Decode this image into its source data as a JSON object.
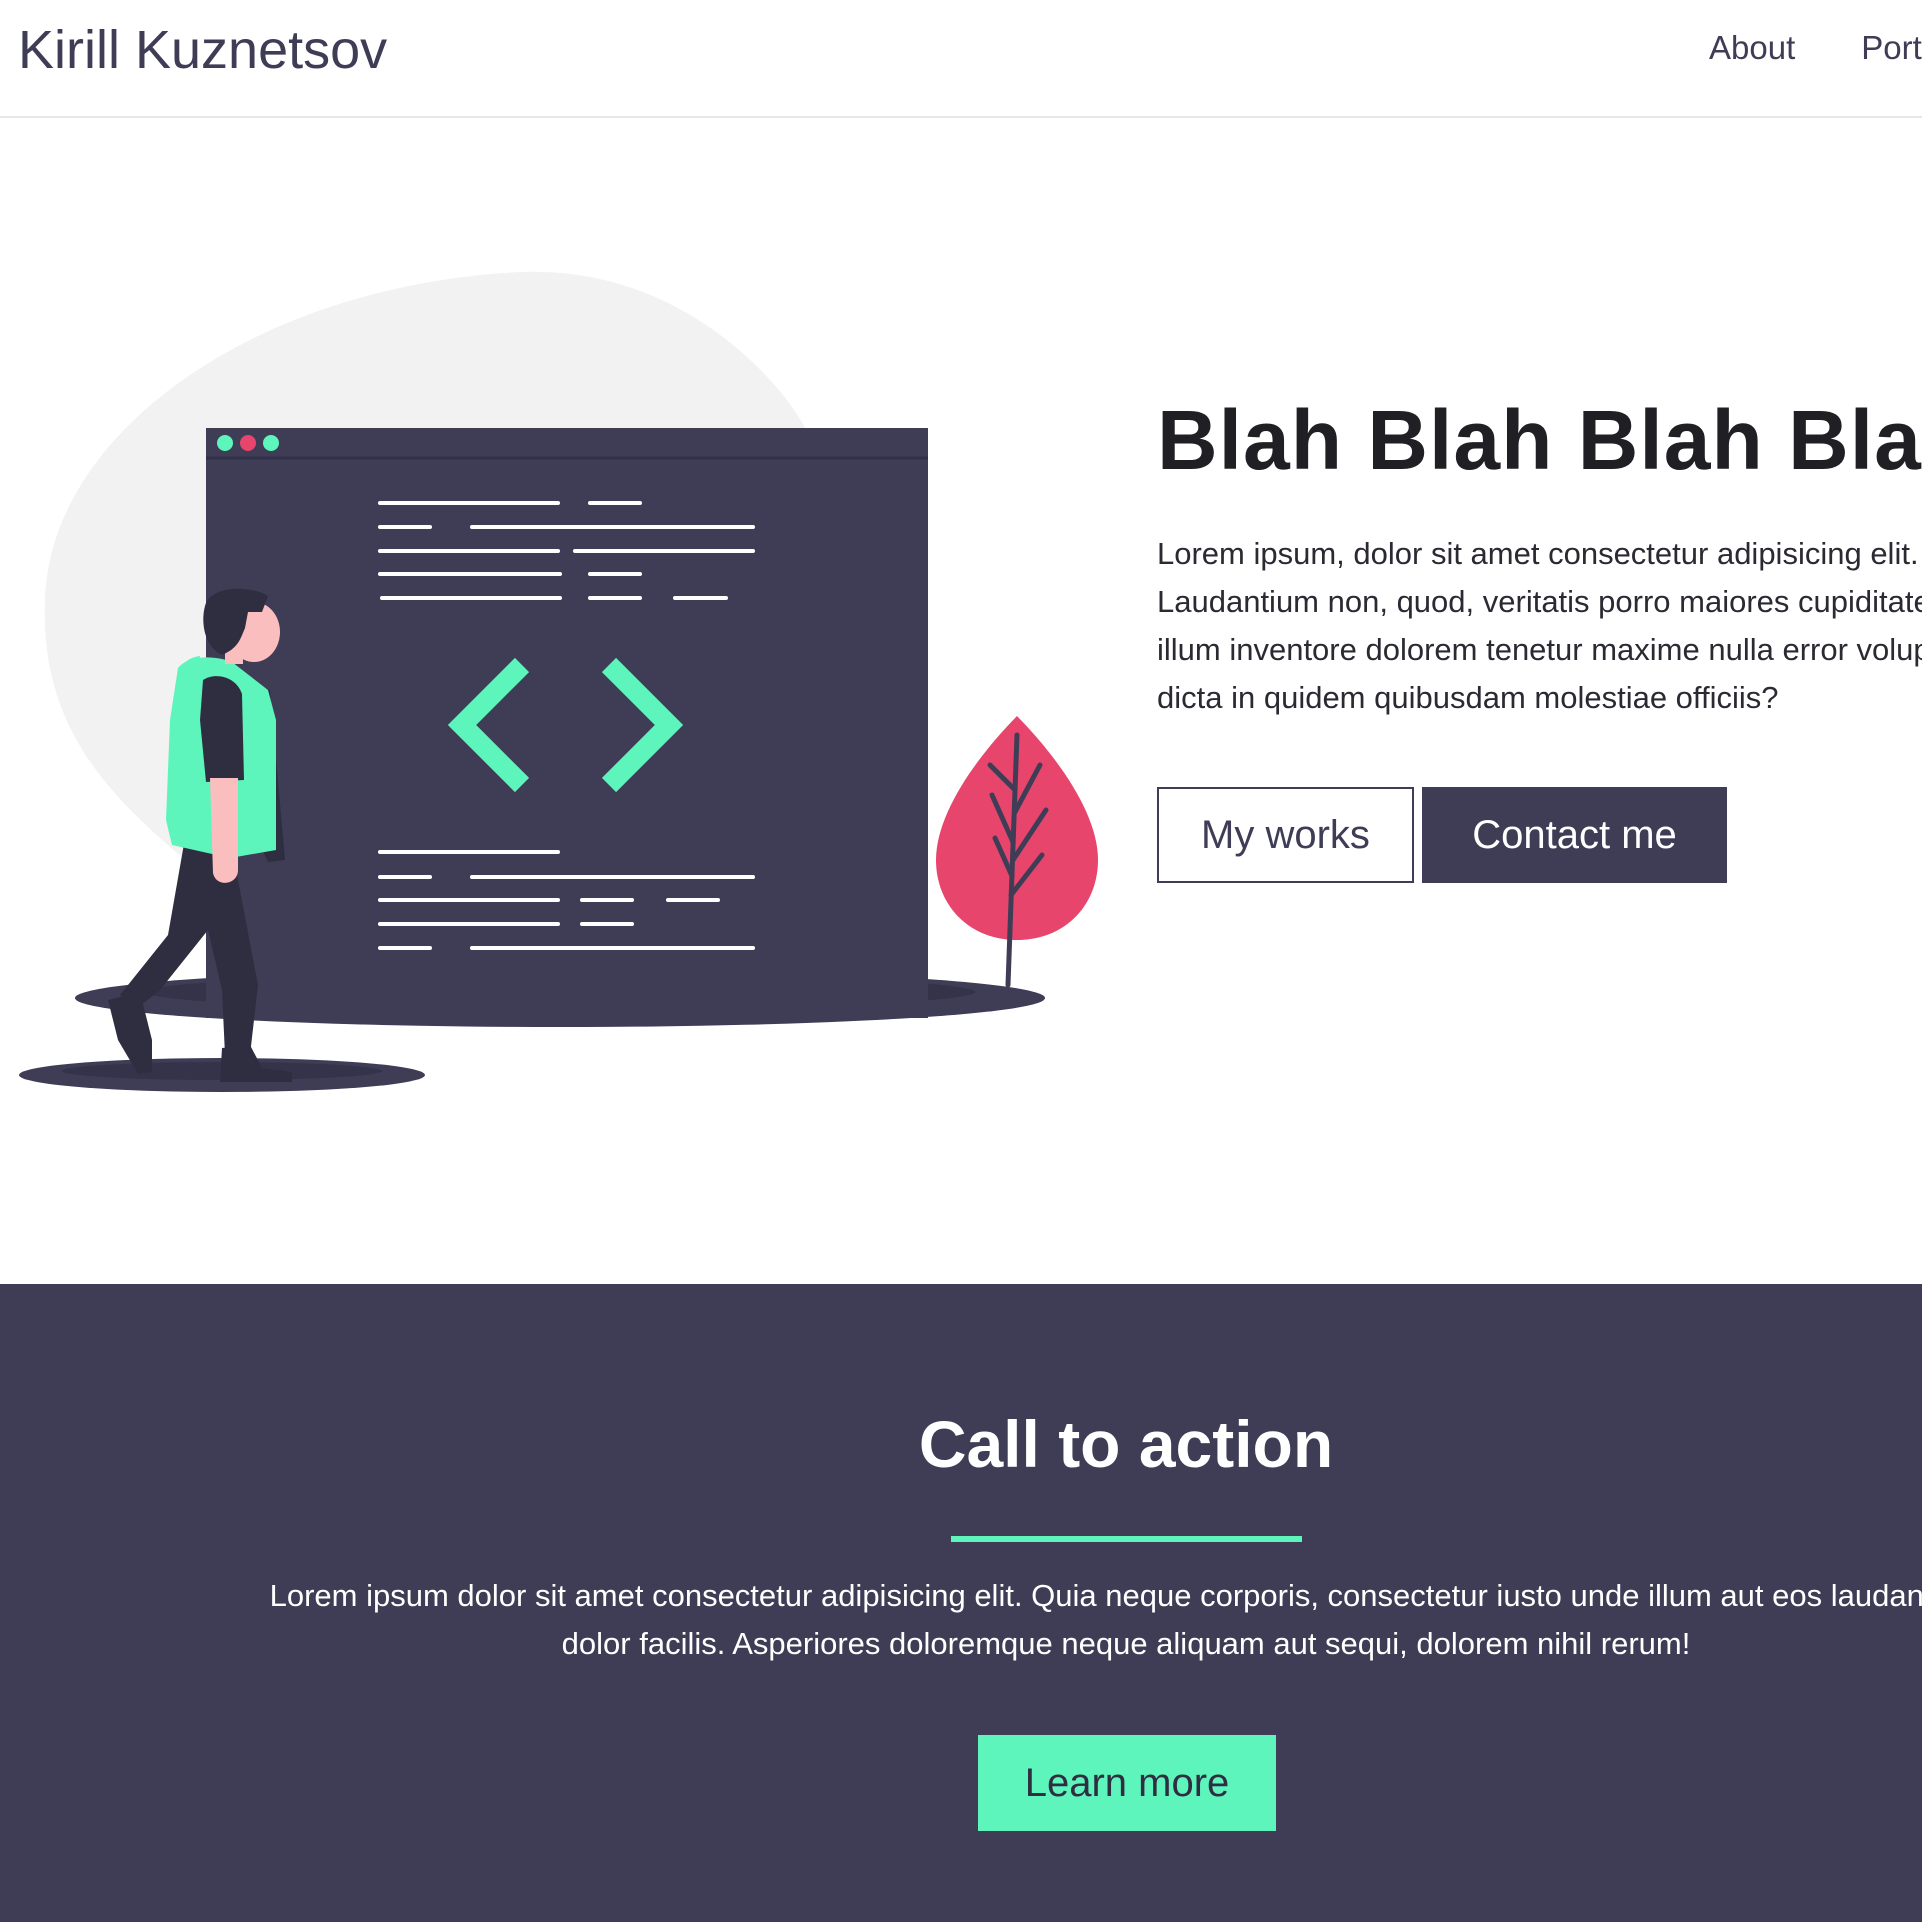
{
  "header": {
    "brand": "Kirill Kuznetsov",
    "nav": [
      "About",
      "Portfolio"
    ]
  },
  "hero": {
    "title": "Blah Blah Blah Blah",
    "text_lines": [
      "Lorem ipsum, dolor sit amet consectetur adipisicing elit.",
      "Laudantium non, quod, veritatis porro maiores cupiditate",
      "illum inventore dolorem tenetur maxime nulla error voluptate",
      "dicta in quidem quibusdam molestiae officiis?"
    ],
    "primary_button": "My works",
    "secondary_button": "Contact me"
  },
  "cta": {
    "title": "Call to action",
    "text_lines": [
      "Lorem ipsum dolor sit amet consectetur adipisicing elit. Quia neque corporis, consectetur iusto unde illum aut eos laudantium",
      "dolor facilis. Asperiores doloremque neque aliquam aut sequi, dolorem nihil rerum!"
    ],
    "button": "Learn more"
  },
  "colors": {
    "dark": "#3f3d56",
    "accent": "#5ef5bd",
    "pink": "#e8456d",
    "blob": "#f2f2f2"
  },
  "icons": [
    "code-brackets-icon",
    "window-dots-icon",
    "leaf-tree-icon",
    "person-illustration"
  ]
}
